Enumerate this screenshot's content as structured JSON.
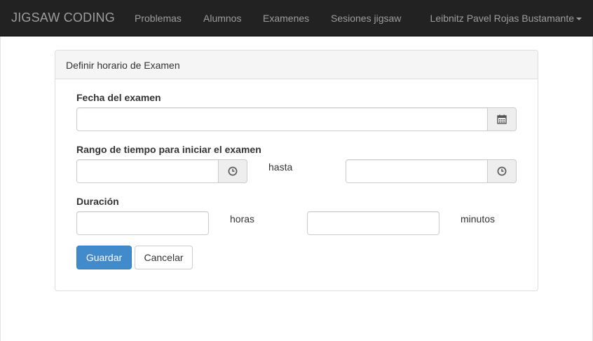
{
  "navbar": {
    "brand": "JIGSAW CODING",
    "links": [
      "Problemas",
      "Alumnos",
      "Examenes",
      "Sesiones jigsaw"
    ],
    "user": "Leibnitz Pavel Rojas Bustamante"
  },
  "panel": {
    "title": "Definir horario de Examen",
    "fecha_label": "Fecha del examen",
    "rango_label": "Rango de tiempo para iniciar el examen",
    "hasta": "hasta",
    "duracion_label": "Duración",
    "horas": "horas",
    "minutos": "minutos",
    "guardar": "Guardar",
    "cancelar": "Cancelar"
  },
  "icons": {
    "calendar": "calendar-icon",
    "clock": "clock-icon"
  },
  "colors": {
    "navbar_bg": "#222222",
    "primary": "#428bca"
  }
}
